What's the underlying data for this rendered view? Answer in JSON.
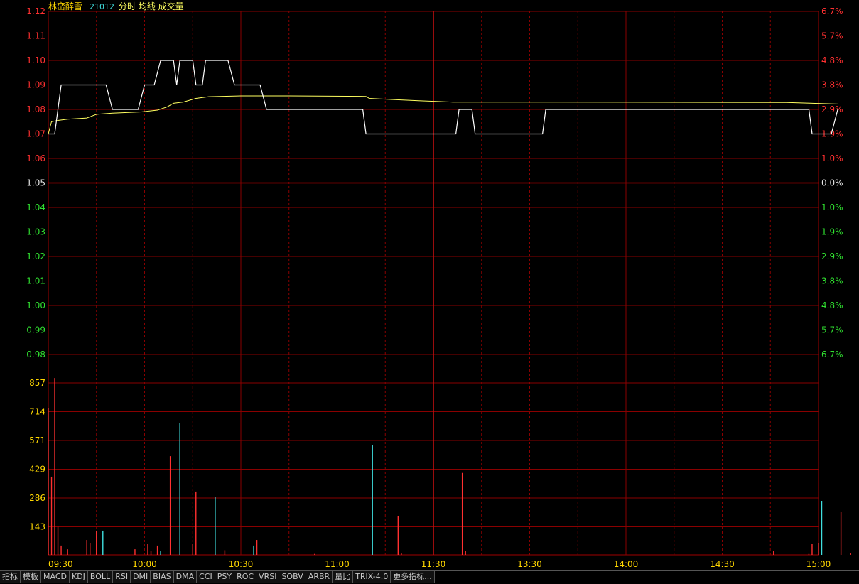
{
  "header": {
    "name": "林峦醉雪",
    "code": "21012",
    "labels": "分时 均线 成交量"
  },
  "colors": {
    "up": "#ff3030",
    "down": "#30e030",
    "flat": "#e8e8e8",
    "volume_axis": "#ffd700",
    "price_line": "#ffffff",
    "avg_line": "#ffff60",
    "grid": "#8a0000",
    "vol_up": "#ff3030",
    "vol_down": "#40e0e0"
  },
  "chart_data": {
    "type": "line",
    "prev_close": 1.05,
    "price_ticks": [
      "1.12",
      "1.11",
      "1.10",
      "1.09",
      "1.08",
      "1.07",
      "1.06",
      "1.05",
      "1.04",
      "1.03",
      "1.02",
      "1.01",
      "1.00",
      "0.99",
      "0.98"
    ],
    "pct_ticks": [
      "6.7%",
      "5.7%",
      "4.8%",
      "3.8%",
      "2.9%",
      "1.9%",
      "1.0%",
      "0.0%",
      "1.0%",
      "1.9%",
      "2.9%",
      "3.8%",
      "4.8%",
      "5.7%",
      "6.7%"
    ],
    "volume_ticks": [
      "857",
      "714",
      "571",
      "429",
      "286",
      "143"
    ],
    "volume_range": [
      0,
      1000
    ],
    "time_ticks": [
      "09:30",
      "10:00",
      "10:30",
      "11:00",
      "11:30",
      "13:30",
      "14:00",
      "14:30",
      "15:00"
    ],
    "price_range": [
      0.975,
      1.125
    ],
    "price_series": [
      [
        0,
        1.07
      ],
      [
        2,
        1.07
      ],
      [
        4,
        1.09
      ],
      [
        18,
        1.09
      ],
      [
        20,
        1.08
      ],
      [
        28,
        1.08
      ],
      [
        30,
        1.09
      ],
      [
        33,
        1.09
      ],
      [
        35,
        1.1
      ],
      [
        39,
        1.1
      ],
      [
        40,
        1.09
      ],
      [
        41,
        1.1
      ],
      [
        45,
        1.1
      ],
      [
        46,
        1.09
      ],
      [
        48,
        1.09
      ],
      [
        49,
        1.1
      ],
      [
        56,
        1.1
      ],
      [
        58,
        1.09
      ],
      [
        66,
        1.09
      ],
      [
        68,
        1.08
      ],
      [
        98,
        1.08
      ],
      [
        99,
        1.07
      ],
      [
        127,
        1.07
      ],
      [
        128,
        1.08
      ],
      [
        132,
        1.08
      ],
      [
        133,
        1.07
      ],
      [
        154,
        1.07
      ],
      [
        155,
        1.08
      ],
      [
        237,
        1.08
      ],
      [
        238,
        1.07
      ],
      [
        244,
        1.07
      ],
      [
        246,
        1.08
      ]
    ],
    "avg_series": [
      [
        0,
        1.07
      ],
      [
        1,
        1.075
      ],
      [
        3,
        1.0755
      ],
      [
        6,
        1.076
      ],
      [
        12,
        1.0765
      ],
      [
        15,
        1.078
      ],
      [
        20,
        1.0785
      ],
      [
        29,
        1.079
      ],
      [
        34,
        1.0797
      ],
      [
        37,
        1.081
      ],
      [
        39,
        1.0825
      ],
      [
        42,
        1.083
      ],
      [
        46,
        1.0845
      ],
      [
        50,
        1.0852
      ],
      [
        60,
        1.0855
      ],
      [
        75,
        1.0855
      ],
      [
        99,
        1.0853
      ],
      [
        100,
        1.0845
      ],
      [
        108,
        1.084
      ],
      [
        116,
        1.0835
      ],
      [
        126,
        1.083
      ],
      [
        160,
        1.083
      ],
      [
        230,
        1.0828
      ],
      [
        246,
        1.0822
      ]
    ],
    "volume_series": [
      [
        0,
        790,
        "up"
      ],
      [
        1,
        420,
        "up"
      ],
      [
        2,
        950,
        "up"
      ],
      [
        3,
        150,
        "up"
      ],
      [
        4,
        50,
        "up"
      ],
      [
        6,
        30,
        "up"
      ],
      [
        12,
        80,
        "up"
      ],
      [
        13,
        65,
        "up"
      ],
      [
        15,
        130,
        "up"
      ],
      [
        17,
        130,
        "down"
      ],
      [
        27,
        30,
        "up"
      ],
      [
        31,
        60,
        "up"
      ],
      [
        32,
        20,
        "up"
      ],
      [
        34,
        50,
        "up"
      ],
      [
        35,
        20,
        "down"
      ],
      [
        38,
        530,
        "up"
      ],
      [
        41,
        710,
        "down"
      ],
      [
        45,
        60,
        "up"
      ],
      [
        46,
        340,
        "up"
      ],
      [
        52,
        310,
        "down"
      ],
      [
        55,
        25,
        "up"
      ],
      [
        64,
        50,
        "down"
      ],
      [
        65,
        80,
        "up"
      ],
      [
        83,
        5,
        "up"
      ],
      [
        101,
        590,
        "down"
      ],
      [
        109,
        210,
        "up"
      ],
      [
        110,
        8,
        "up"
      ],
      [
        129,
        440,
        "up"
      ],
      [
        130,
        20,
        "up"
      ],
      [
        226,
        20,
        "up"
      ],
      [
        237,
        5,
        "up"
      ],
      [
        238,
        60,
        "up"
      ],
      [
        240,
        65,
        "up"
      ],
      [
        241,
        290,
        "down"
      ],
      [
        247,
        230,
        "up"
      ],
      [
        250,
        10,
        "up"
      ]
    ],
    "minutes_total": 241
  },
  "toolbar": {
    "tabs": [
      "指标",
      "模板",
      "MACD",
      "KDJ",
      "BOLL",
      "RSI",
      "DMI",
      "BIAS",
      "DMA",
      "CCI",
      "PSY",
      "ROC",
      "VRSI",
      "SOBV",
      "ARBR",
      "量比",
      "TRIX-4.0",
      "更多指标..."
    ]
  }
}
